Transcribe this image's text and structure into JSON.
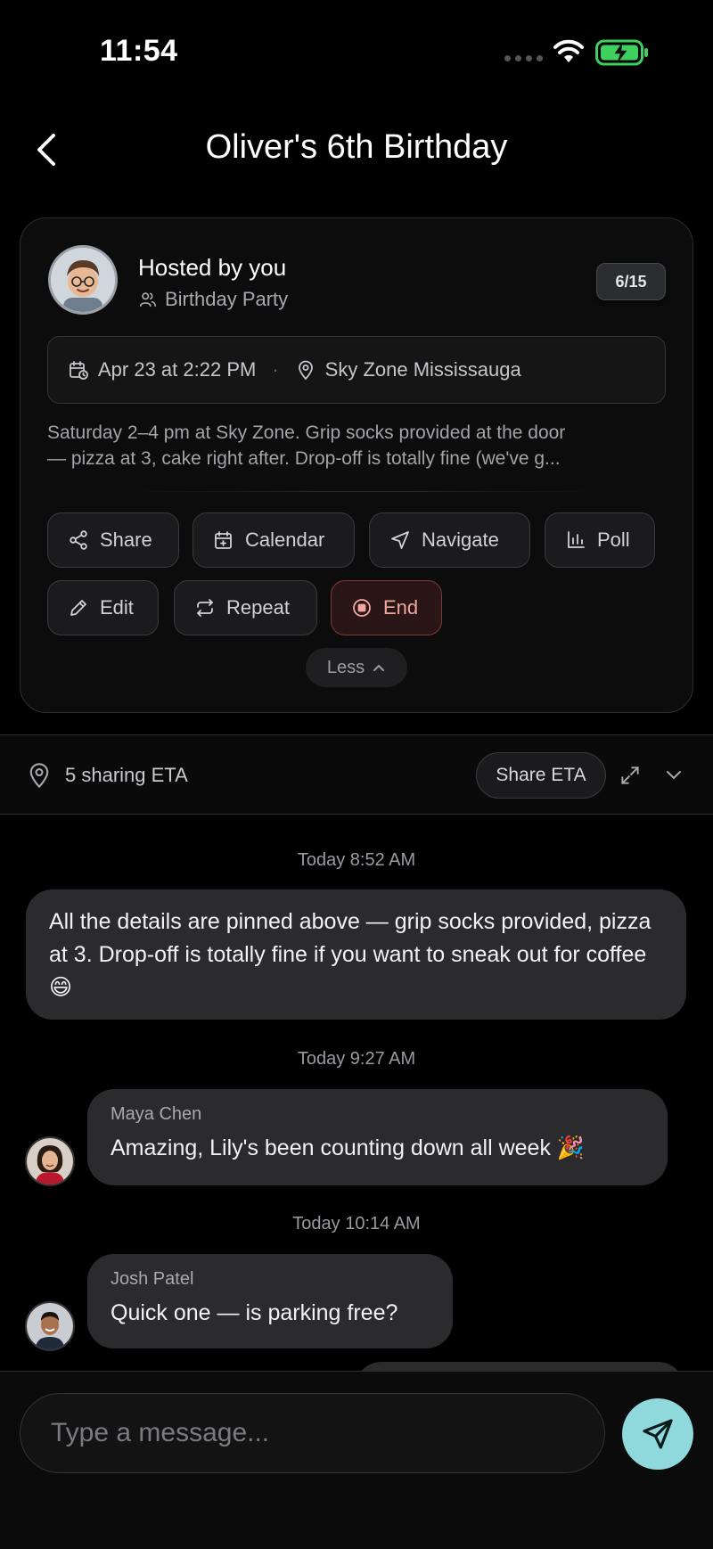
{
  "status": {
    "time": "11:54"
  },
  "header": {
    "title": "Oliver's 6th Birthday"
  },
  "event": {
    "host_label": "Hosted by you",
    "type_label": "Birthday Party",
    "count": "6/15",
    "date": "Apr 23 at 2:22 PM",
    "separator": "·",
    "location": "Sky Zone Mississauga",
    "description_line1": "Saturday 2–4 pm at Sky Zone. Grip socks provided at the door",
    "description_line2": "— pizza at 3, cake right after. Drop-off is totally fine (we've g...",
    "actions": {
      "share": "Share",
      "calendar": "Calendar",
      "navigate": "Navigate",
      "poll": "Poll",
      "edit": "Edit",
      "repeat": "Repeat",
      "end": "End"
    },
    "less": "Less"
  },
  "eta": {
    "text": "5 sharing ETA",
    "button": "Share ETA"
  },
  "messages": [
    {
      "timestamp": "Today 8:52 AM",
      "sender": "",
      "text": "All the details are pinned above — grip socks provided, pizza at 3. Drop-off is totally fine if you want to sneak out for coffee 😄"
    },
    {
      "timestamp": "Today 9:27 AM",
      "sender": "Maya Chen",
      "text": "Amazing, Lily's been counting down all week 🎉"
    },
    {
      "timestamp": "Today 10:14 AM",
      "sender": "Josh Patel",
      "text": "Quick one — is parking free?"
    }
  ],
  "composer": {
    "placeholder": "Type a message..."
  },
  "colors": {
    "accent": "#8fd8dc",
    "end": "#f1a7a0",
    "battery": "#3ecf5e"
  }
}
